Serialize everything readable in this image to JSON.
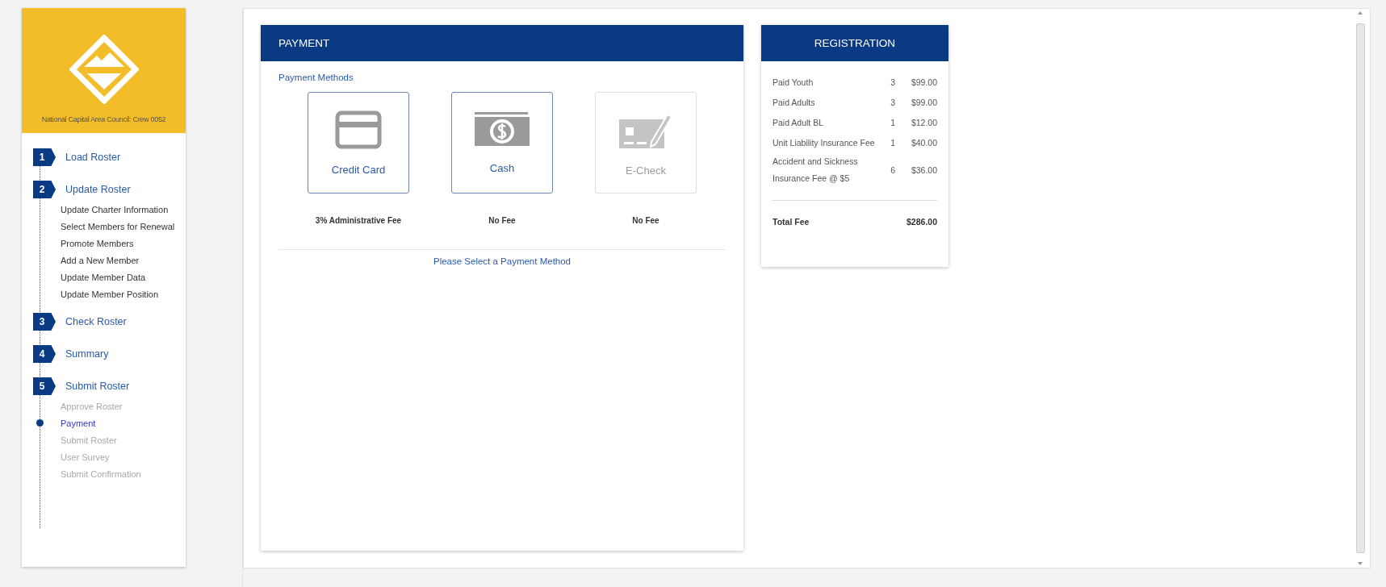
{
  "sidebar": {
    "unit_name": "National Capital Area Council: Crew 0052",
    "steps": [
      {
        "number": "1",
        "label": "Load Roster"
      },
      {
        "number": "2",
        "label": "Update Roster",
        "children": [
          {
            "label": "Update Charter Information",
            "current": false,
            "disabled": false
          },
          {
            "label": "Select Members for Renewal",
            "current": false,
            "disabled": false
          },
          {
            "label": "Promote Members",
            "current": false,
            "disabled": false
          },
          {
            "label": "Add a New Member",
            "current": false,
            "disabled": false
          },
          {
            "label": "Update Member Data",
            "current": false,
            "disabled": false
          },
          {
            "label": "Update Member Position",
            "current": false,
            "disabled": false
          }
        ]
      },
      {
        "number": "3",
        "label": "Check Roster"
      },
      {
        "number": "4",
        "label": "Summary"
      },
      {
        "number": "5",
        "label": "Submit Roster",
        "children": [
          {
            "label": "Approve Roster",
            "current": false,
            "disabled": true
          },
          {
            "label": "Payment",
            "current": true,
            "disabled": false
          },
          {
            "label": "Submit Roster",
            "current": false,
            "disabled": true
          },
          {
            "label": "User Survey",
            "current": false,
            "disabled": true
          },
          {
            "label": "Submit Confirmation",
            "current": false,
            "disabled": true
          }
        ]
      }
    ]
  },
  "payment": {
    "title": "PAYMENT",
    "section_label": "Payment Methods",
    "methods": [
      {
        "kind": "card",
        "label": "Credit Card",
        "fee": "3% Administrative Fee",
        "disabled": false
      },
      {
        "kind": "cash",
        "label": "Cash",
        "fee": "No Fee",
        "disabled": false
      },
      {
        "kind": "check",
        "label": "E-Check",
        "fee": "No Fee",
        "disabled": true
      }
    ],
    "prompt": "Please Select a Payment Method"
  },
  "registration": {
    "title": "REGISTRATION",
    "rows": [
      {
        "label": "Paid Youth",
        "count": "3",
        "amount": "$99.00"
      },
      {
        "label": "Paid Adults",
        "count": "3",
        "amount": "$99.00"
      },
      {
        "label": "Paid Adult BL",
        "count": "1",
        "amount": "$12.00"
      },
      {
        "label": "Unit Liability Insurance Fee",
        "count": "1",
        "amount": "$40.00"
      },
      {
        "label": "Accident and Sickness Insurance Fee @ $5",
        "count": "6",
        "amount": "$36.00"
      }
    ],
    "total_label": "Total Fee",
    "total": "$286.00"
  }
}
